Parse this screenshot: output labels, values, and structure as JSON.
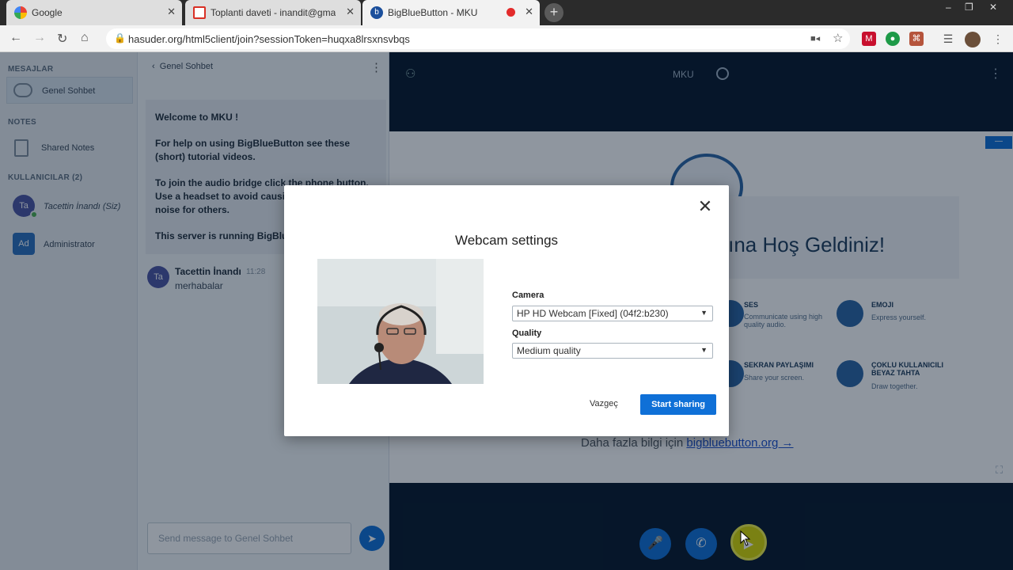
{
  "browser": {
    "tabs": [
      {
        "title": "Google"
      },
      {
        "title": "Toplanti daveti - inandit@gmail.com"
      },
      {
        "title": "BigBlueButton - MKU"
      }
    ],
    "url": "hasuder.org/html5client/join?sessionToken=huqxa8lrsxnsvbqs",
    "window_controls": [
      "–",
      "❐",
      "✕"
    ]
  },
  "sidebar": {
    "messages_title": "MESAJLAR",
    "public_chat_label": "Genel Sohbet",
    "notes_title": "NOTES",
    "shared_notes_label": "Shared Notes",
    "users_title": "KULLANICILAR (2)",
    "users": [
      {
        "initials": "Ta",
        "name": "Tacettin İnandı (Siz)",
        "color": "#4b54a3"
      },
      {
        "initials": "Ad",
        "name": "Administrator",
        "color": "#2a6fbd"
      }
    ]
  },
  "chat": {
    "header_title": "Genel Sohbet",
    "welcome": {
      "line1": "Welcome to MKU !",
      "line2": "For help on using BigBlueButton see these (short) tutorial videos.",
      "line3": "To join the audio bridge click the phone button. Use a headset to avoid causing background noise for others.",
      "line4": "This server is running BigBlueButton."
    },
    "message": {
      "initials": "Ta",
      "sender": "Tacettin İnandı",
      "time": "11:28",
      "text": "merhabalar"
    },
    "input_placeholder": "Send message to Genel Sohbet"
  },
  "main": {
    "meeting_name": "MKU",
    "slide": {
      "title": "arına Hoş Geldiniz!",
      "features": [
        {
          "title": "SES",
          "desc": "Communicate using high quality audio."
        },
        {
          "title": "EMOJI",
          "desc": "Express yourself."
        },
        {
          "title": "SEKRAN PAYLAŞIMI",
          "desc": "Share your screen."
        },
        {
          "title": "ÇOKLU KULLANICILI BEYAZ TAHTA",
          "desc": "Draw together."
        }
      ],
      "more_info_prefix": "Daha fazla bilgi için",
      "more_info_link": "bigbluebutton.org →"
    }
  },
  "modal": {
    "title": "Webcam settings",
    "camera_label": "Camera",
    "camera_value": "HP HD Webcam [Fixed] (04f2:b230)",
    "quality_label": "Quality",
    "quality_value": "Medium quality",
    "cancel_label": "Vazgeç",
    "share_label": "Start sharing"
  },
  "colors": {
    "accent": "#0f70d7",
    "app_bg": "#06172a",
    "sidebar_bg": "#e9edf1"
  }
}
